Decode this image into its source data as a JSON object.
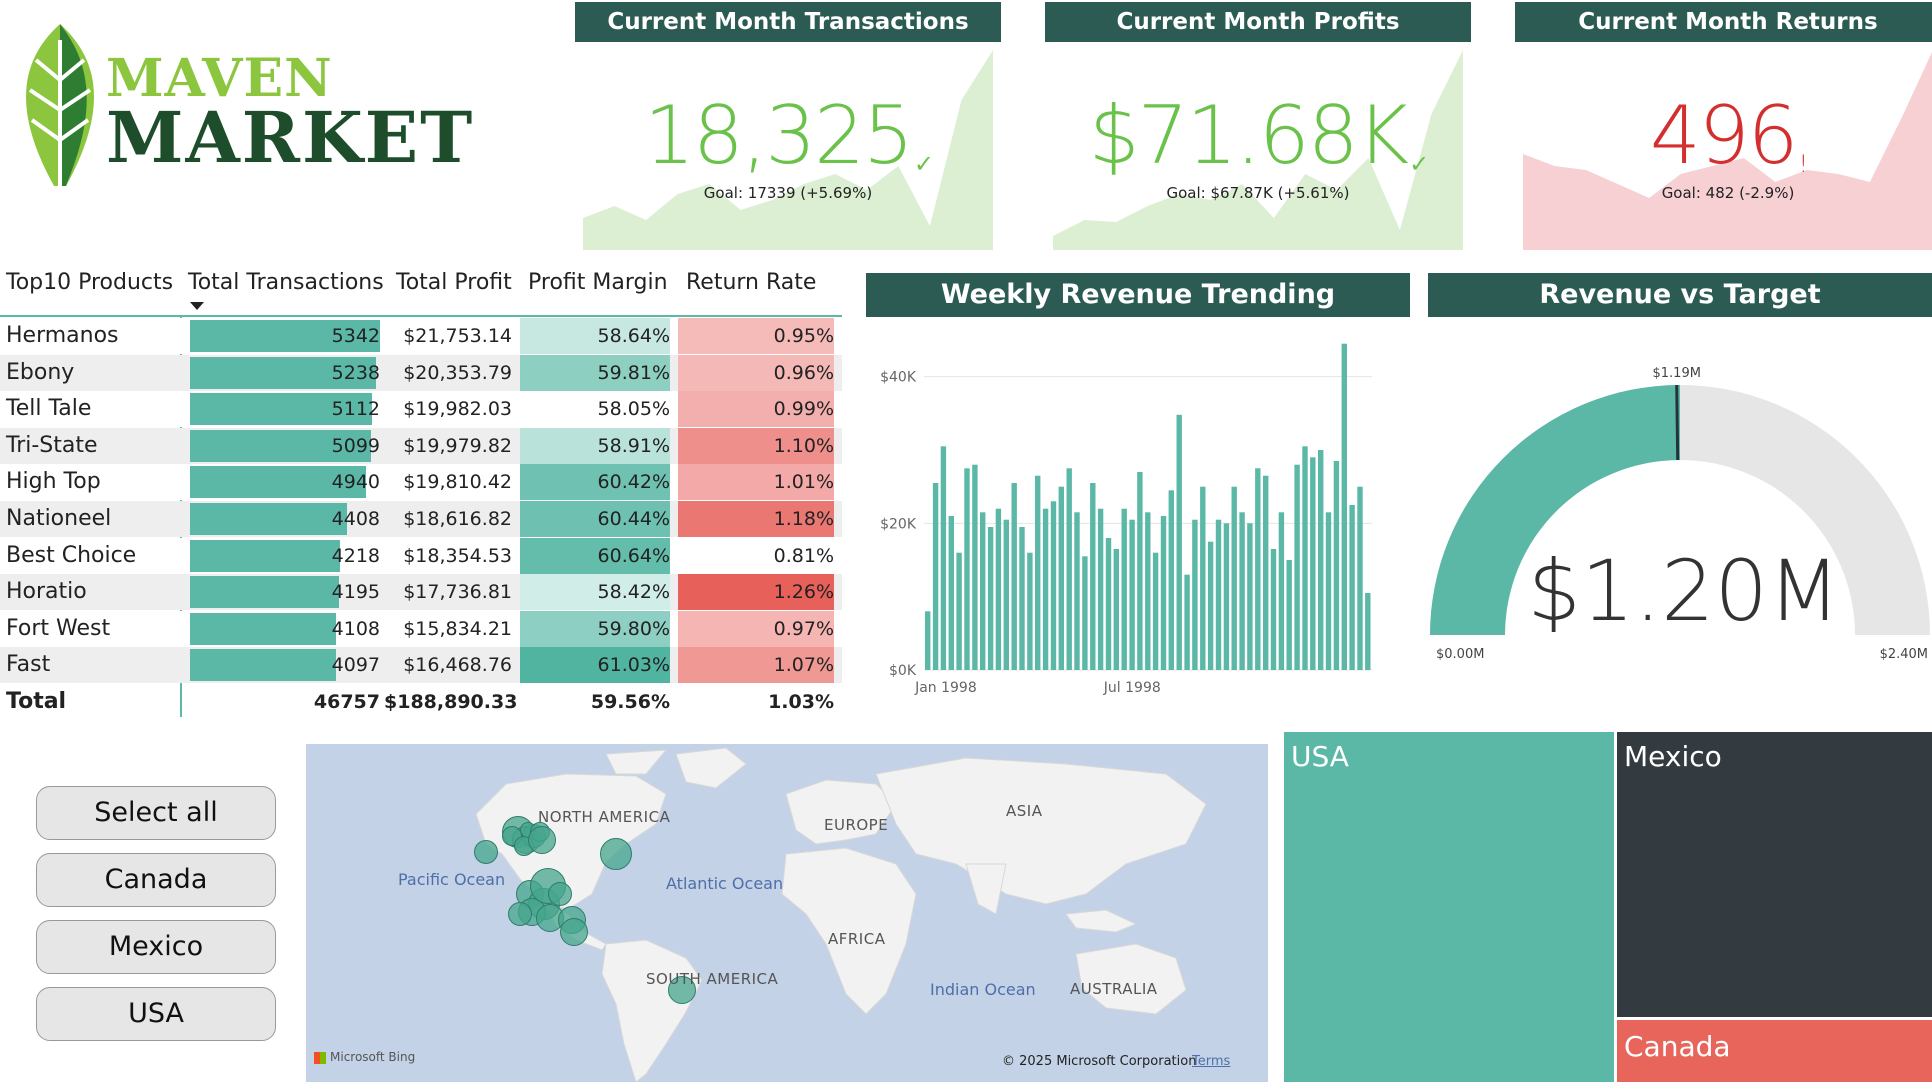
{
  "logo": {
    "line1": "MAVEN",
    "line2": "MARKET"
  },
  "kpis": [
    {
      "title": "Current Month Transactions",
      "value": "18,325",
      "indicator": "✓",
      "goal": "Goal: 17339 (+5.69%)",
      "color": "#6ac24a",
      "fill": "#dcefd2"
    },
    {
      "title": "Current Month Profits",
      "value": "$71.68K",
      "indicator": "✓",
      "goal": "Goal: $67.87K (+5.61%)",
      "color": "#6ac24a",
      "fill": "#dcefd2"
    },
    {
      "title": "Current Month Returns",
      "value": "496",
      "indicator": "!",
      "goal": "Goal: 482 (-2.9%)",
      "color": "#d32f2f",
      "fill": "#f7d0d4"
    }
  ],
  "matrix": {
    "headers": [
      "Top10 Products",
      "Total Transactions",
      "Total Profit",
      "Profit Margin",
      "Return Rate"
    ],
    "rows": [
      {
        "product": "Hermanos",
        "transactions": 5342,
        "profit": "$21,753.14",
        "margin": "58.64%",
        "margin_val": 58.64,
        "rate": "0.95%",
        "rate_val": 0.95
      },
      {
        "product": "Ebony",
        "transactions": 5238,
        "profit": "$20,353.79",
        "margin": "59.81%",
        "margin_val": 59.81,
        "rate": "0.96%",
        "rate_val": 0.96
      },
      {
        "product": "Tell Tale",
        "transactions": 5112,
        "profit": "$19,982.03",
        "margin": "58.05%",
        "margin_val": 58.05,
        "rate": "0.99%",
        "rate_val": 0.99
      },
      {
        "product": "Tri-State",
        "transactions": 5099,
        "profit": "$19,979.82",
        "margin": "58.91%",
        "margin_val": 58.91,
        "rate": "1.10%",
        "rate_val": 1.1
      },
      {
        "product": "High Top",
        "transactions": 4940,
        "profit": "$19,810.42",
        "margin": "60.42%",
        "margin_val": 60.42,
        "rate": "1.01%",
        "rate_val": 1.01
      },
      {
        "product": "Nationeel",
        "transactions": 4408,
        "profit": "$18,616.82",
        "margin": "60.44%",
        "margin_val": 60.44,
        "rate": "1.18%",
        "rate_val": 1.18
      },
      {
        "product": "Best Choice",
        "transactions": 4218,
        "profit": "$18,354.53",
        "margin": "60.64%",
        "margin_val": 60.64,
        "rate": "0.81%",
        "rate_val": 0.81
      },
      {
        "product": "Horatio",
        "transactions": 4195,
        "profit": "$17,736.81",
        "margin": "58.42%",
        "margin_val": 58.42,
        "rate": "1.26%",
        "rate_val": 1.26
      },
      {
        "product": "Fort West",
        "transactions": 4108,
        "profit": "$15,834.21",
        "margin": "59.80%",
        "margin_val": 59.8,
        "rate": "0.97%",
        "rate_val": 0.97
      },
      {
        "product": "Fast",
        "transactions": 4097,
        "profit": "$16,468.76",
        "margin": "61.03%",
        "margin_val": 61.03,
        "rate": "1.07%",
        "rate_val": 1.07
      }
    ],
    "total": {
      "label": "Total",
      "transactions": "46757",
      "profit": "$188,890.33",
      "margin": "59.56%",
      "rate": "1.03%"
    }
  },
  "weekly": {
    "title": "Weekly Revenue Trending",
    "chart_data": {
      "type": "bar",
      "y_ticks": [
        "$40K",
        "$20K",
        "$0K"
      ],
      "x_ticks": [
        "Jan 1998",
        "Jul 1998"
      ],
      "ylim": [
        0,
        45000
      ],
      "values": [
        8000,
        25500,
        30500,
        21000,
        16000,
        27500,
        28000,
        21500,
        19500,
        22000,
        20500,
        25500,
        19500,
        16000,
        26500,
        22000,
        23000,
        25000,
        27500,
        21500,
        15500,
        25500,
        22000,
        18000,
        16500,
        22000,
        20500,
        27000,
        21500,
        16000,
        21000,
        24500,
        34800,
        13000,
        20500,
        25000,
        17500,
        20500,
        20000,
        25000,
        21500,
        20000,
        27500,
        26500,
        16500,
        21500,
        15000,
        28000,
        30500,
        29000,
        30000,
        21500,
        28500,
        44500,
        22500,
        25000,
        10500
      ],
      "color": "#5bb8a6"
    }
  },
  "gauge": {
    "title": "Revenue vs Target",
    "value_label": "$1.20M",
    "target_label": "$1.19M",
    "min_label": "$0.00M",
    "max_label": "$2.40M",
    "value": 1.2,
    "target": 1.19,
    "max": 2.4,
    "fill": "#5bb8a6",
    "track": "#e6e6e6"
  },
  "slicer": {
    "buttons": [
      "Select all",
      "Canada",
      "Mexico",
      "USA"
    ]
  },
  "map": {
    "continents": [
      "NORTH AMERICA",
      "EUROPE",
      "ASIA",
      "AFRICA",
      "SOUTH AMERICA",
      "AUSTRALIA"
    ],
    "oceans": [
      "Pacific Ocean",
      "Atlantic Ocean",
      "Indian Ocean"
    ],
    "brand": "Microsoft Bing",
    "copyright": "© 2025 Microsoft Corporation",
    "terms": "Terms"
  },
  "treemap": {
    "items": [
      {
        "label": "USA",
        "color": "#5bb8a6"
      },
      {
        "label": "Mexico",
        "color": "#343b40"
      },
      {
        "label": "Canada",
        "color": "#e8655c"
      }
    ]
  }
}
